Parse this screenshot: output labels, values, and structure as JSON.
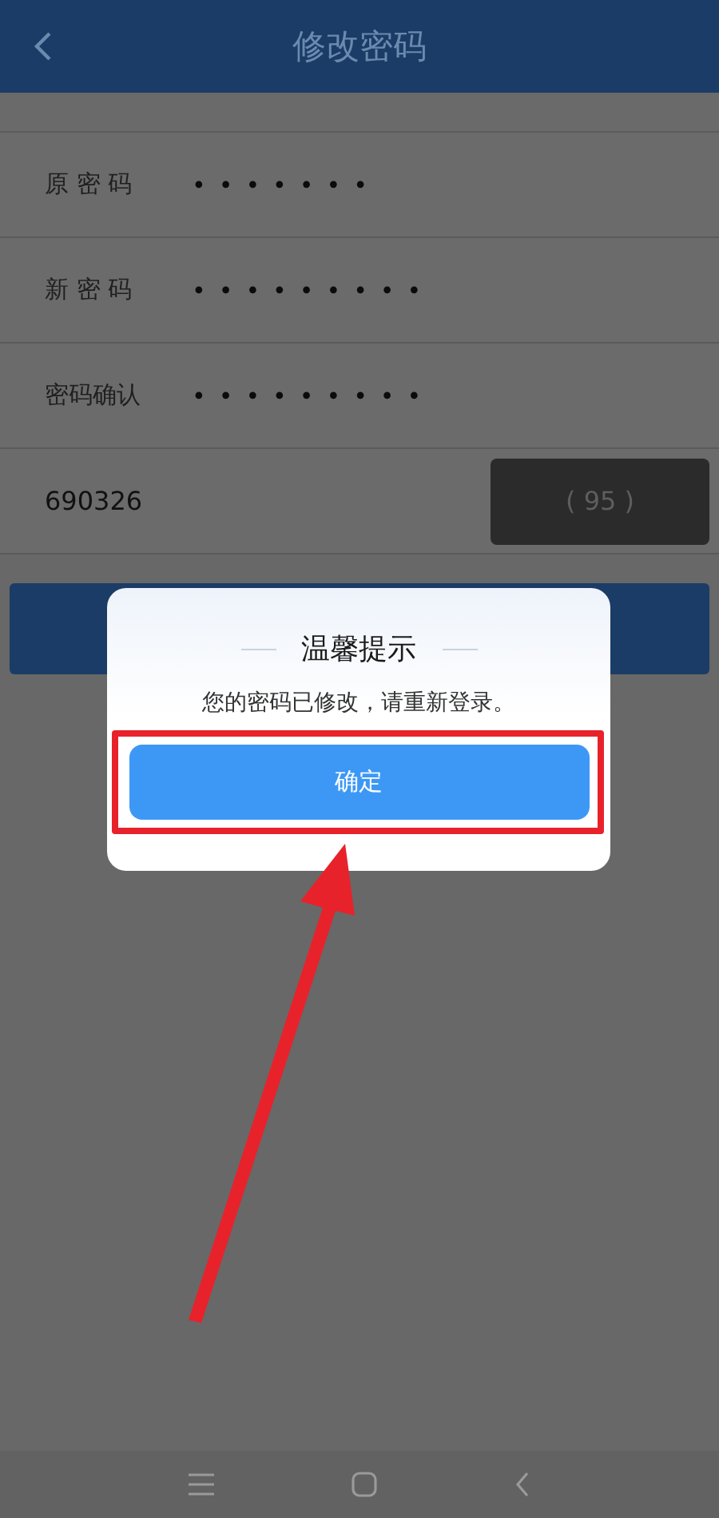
{
  "header": {
    "title": "修改密码"
  },
  "fields": [
    {
      "kind": "password",
      "label": "原 密 码",
      "value": "•••••••"
    },
    {
      "kind": "password",
      "label": "新 密 码",
      "value": "•••••••••"
    },
    {
      "kind": "password",
      "label": "密码确认",
      "value": "•••••••••"
    },
    {
      "kind": "code",
      "value": "690326",
      "countdown": "( 95 )"
    }
  ],
  "dialog": {
    "title": "温馨提示",
    "message": "您的密码已修改，请重新登录。",
    "confirm": "确定"
  }
}
